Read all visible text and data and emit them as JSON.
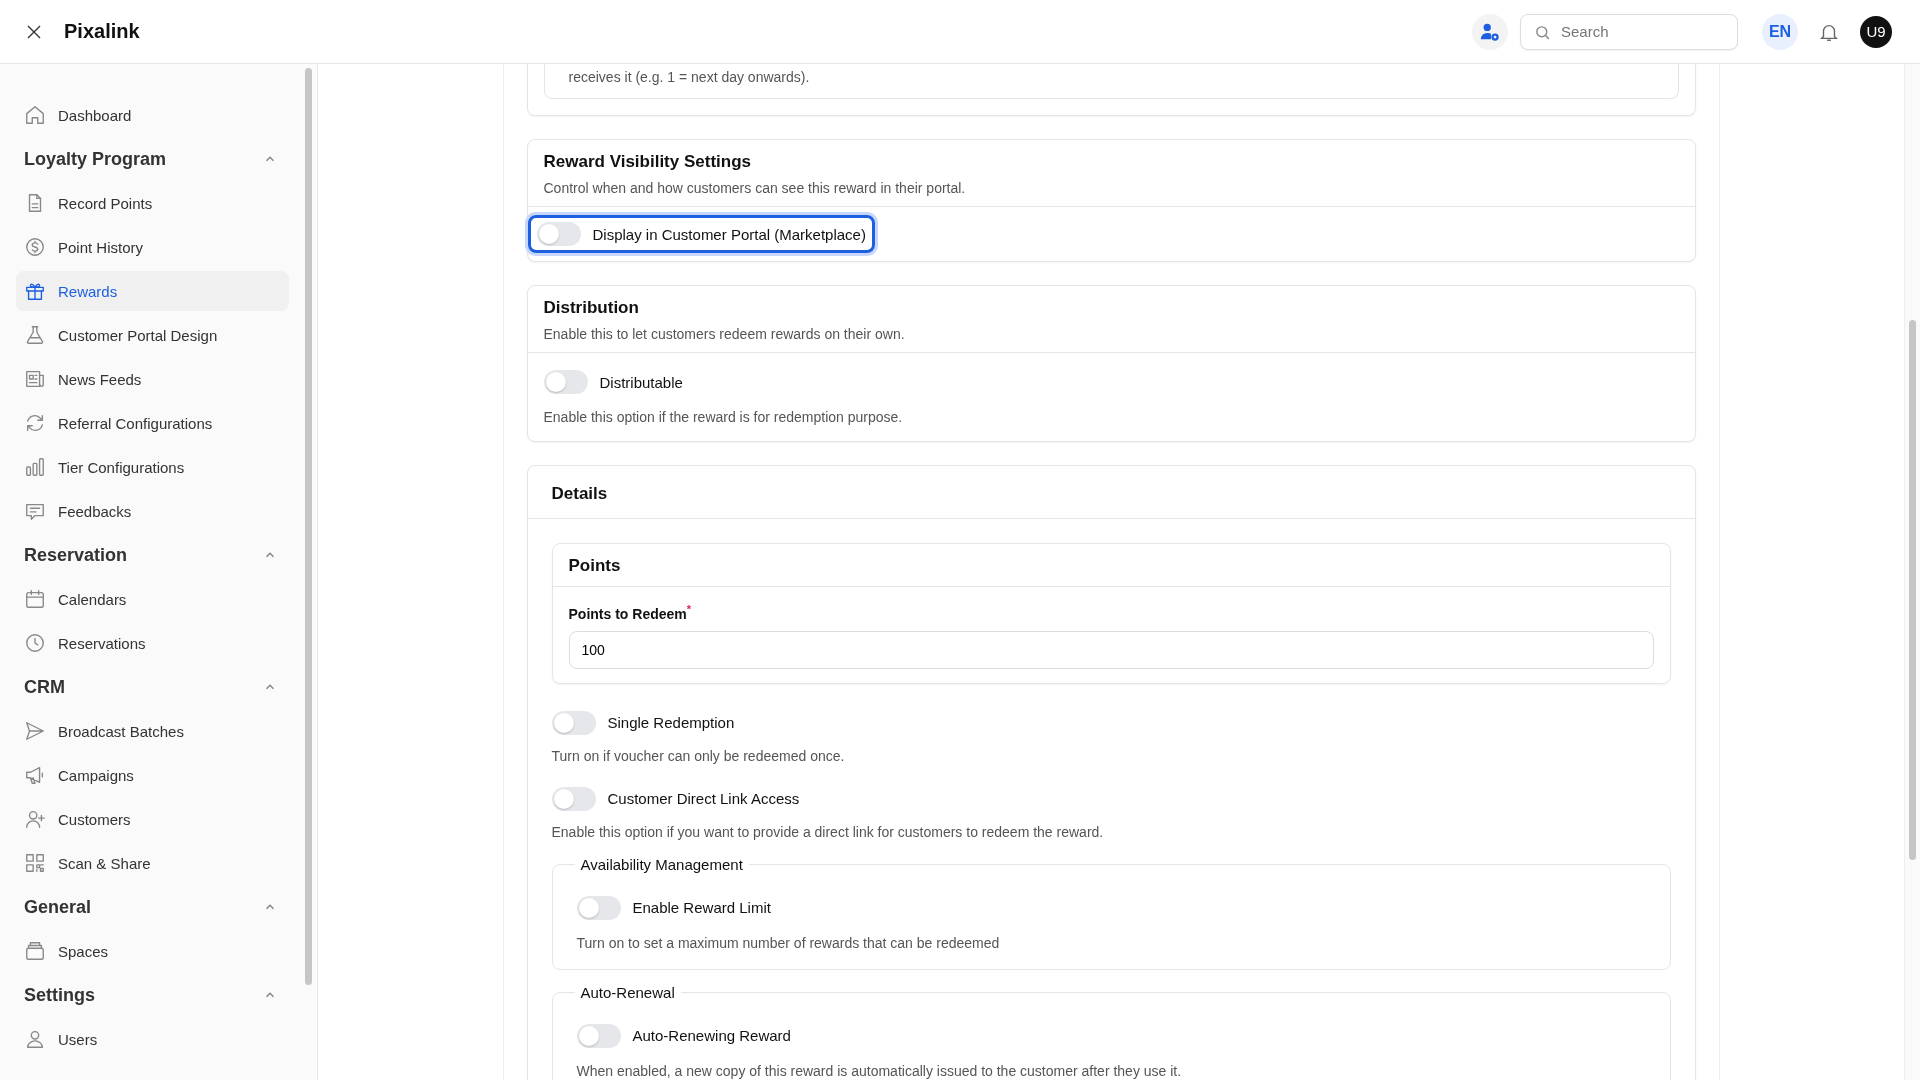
{
  "app": {
    "title": "Pixalink"
  },
  "header": {
    "search": {
      "placeholder": "Search"
    },
    "language": "EN",
    "avatar": "U9"
  },
  "sidebar": {
    "top_items": [
      {
        "label": "Dashboard",
        "selected": false
      }
    ],
    "sections": [
      {
        "title": "Loyalty Program",
        "expanded": true,
        "items": [
          {
            "label": "Record Points",
            "selected": false
          },
          {
            "label": "Point History",
            "selected": false
          },
          {
            "label": "Rewards",
            "selected": true
          },
          {
            "label": "Customer Portal Design",
            "selected": false
          },
          {
            "label": "News Feeds",
            "selected": false
          },
          {
            "label": "Referral Configurations",
            "selected": false
          },
          {
            "label": "Tier Configurations",
            "selected": false
          },
          {
            "label": "Feedbacks",
            "selected": false
          }
        ]
      },
      {
        "title": "Reservation",
        "expanded": true,
        "items": [
          {
            "label": "Calendars",
            "selected": false
          },
          {
            "label": "Reservations",
            "selected": false
          }
        ]
      },
      {
        "title": "CRM",
        "expanded": true,
        "items": [
          {
            "label": "Broadcast Batches",
            "selected": false
          },
          {
            "label": "Campaigns",
            "selected": false
          },
          {
            "label": "Customers",
            "selected": false
          },
          {
            "label": "Scan & Share",
            "selected": false
          }
        ]
      },
      {
        "title": "General",
        "expanded": true,
        "items": [
          {
            "label": "Spaces",
            "selected": false
          }
        ]
      },
      {
        "title": "Settings",
        "expanded": true,
        "items": [
          {
            "label": "Users",
            "selected": false
          }
        ]
      }
    ]
  },
  "main": {
    "top_fragment": "receives it (e.g. 1 = next day onwards).",
    "visibility": {
      "title": "Reward Visibility Settings",
      "description": "Control when and how customers can see this reward in their portal.",
      "toggle": {
        "label": "Display in Customer Portal (Marketplace)",
        "on": false,
        "focused": true
      }
    },
    "distribution": {
      "title": "Distribution",
      "description": "Enable this to let customers redeem rewards on their own.",
      "toggle": {
        "label": "Distributable",
        "on": false,
        "focused": false
      },
      "hint": "Enable this option if the reward is for redemption purpose."
    },
    "details": {
      "title": "Details",
      "points": {
        "title": "Points",
        "field": {
          "label": "Points to Redeem",
          "required_mark": "*",
          "value": "100"
        }
      },
      "options": [
        {
          "label": "Single Redemption",
          "on": false,
          "hint": "Turn on if voucher can only be redeemed once."
        },
        {
          "label": "Customer Direct Link Access",
          "on": false,
          "hint": "Enable this option if you want to provide a direct link for customers to redeem the reward."
        }
      ],
      "groups": [
        {
          "legend": "Availability Management",
          "toggle": {
            "label": "Enable Reward Limit",
            "on": false
          },
          "hint": "Turn on to set a maximum number of rewards that can be redeemed"
        },
        {
          "legend": "Auto-Renewal",
          "toggle": {
            "label": "Auto-Renewing Reward",
            "on": false
          },
          "hint": "When enabled, a new copy of this reward is automatically issued to the customer after they use it."
        }
      ]
    }
  }
}
